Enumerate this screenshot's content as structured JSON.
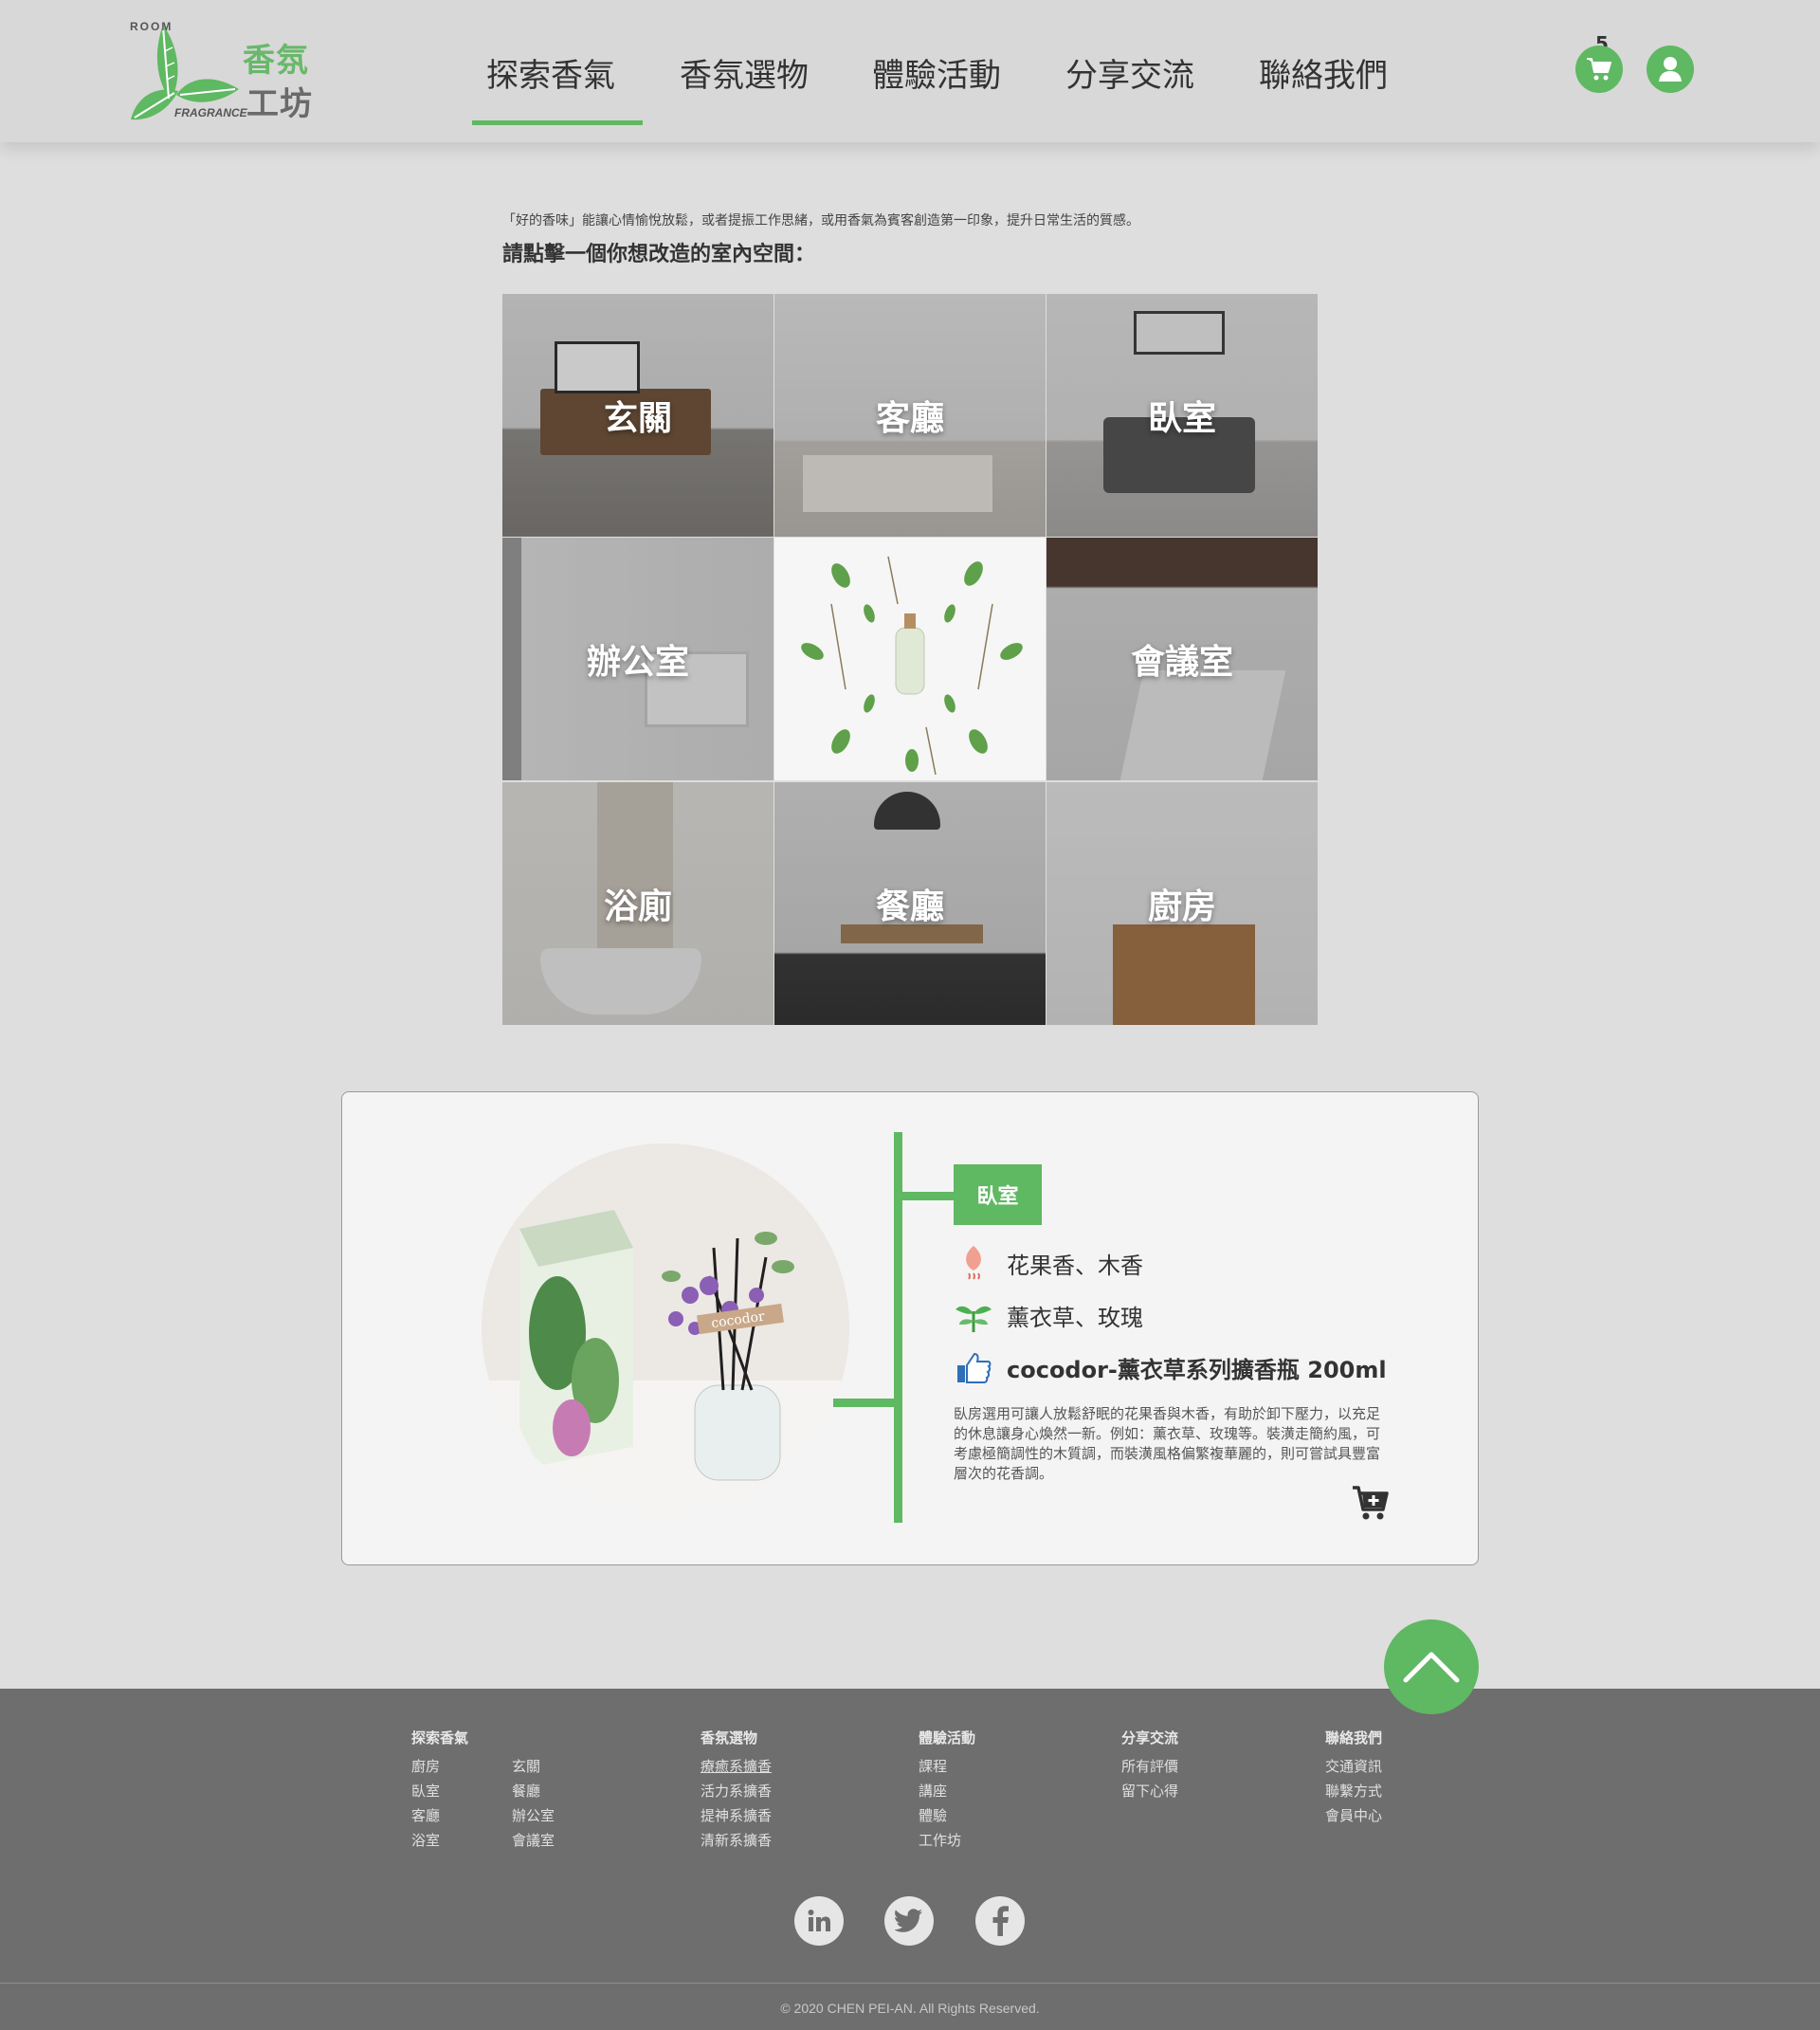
{
  "brand": {
    "logo_top": "ROOM",
    "logo_main": "香氛",
    "logo_sub": "工坊",
    "logo_bottom": "FRAGRANCE"
  },
  "nav": {
    "items": [
      {
        "label": "探索香氣"
      },
      {
        "label": "香氛選物"
      },
      {
        "label": "體驗活動"
      },
      {
        "label": "分享交流"
      },
      {
        "label": "聯絡我們"
      }
    ],
    "active_index": 0,
    "cart_count": "5"
  },
  "intro": {
    "subtitle": "「好的香味」能讓心情愉悅放鬆，或者提振工作思緒，或用香氣為賓客創造第一印象，提升日常生活的質感。",
    "title": "請點擊一個你想改造的室內空間："
  },
  "rooms": [
    {
      "label": "玄關"
    },
    {
      "label": "客廳"
    },
    {
      "label": "臥室"
    },
    {
      "label": "辦公室"
    },
    {
      "label": ""
    },
    {
      "label": "會議室"
    },
    {
      "label": "浴廁"
    },
    {
      "label": "餐廳"
    },
    {
      "label": "廚房"
    }
  ],
  "feature": {
    "tag": "臥室",
    "scent": "花果香、木香",
    "herb": "薰衣草、玫瑰",
    "product": "cocodor-薰衣草系列擴香瓶 200ml",
    "description": "臥房選用可讓人放鬆舒眠的花果香與木香，有助於卸下壓力，以充足的休息讓身心煥然一新。例如：薰衣草、玫瑰等。裝潢走簡約風，可考慮極簡調性的木質調，而裝潢風格偏繁複華麗的，則可嘗試具豐富層次的花香調。",
    "product_brand_text": "cocodor"
  },
  "footer": {
    "columns": [
      {
        "title": "探索香氣",
        "links": [
          "廚房",
          "臥室",
          "客廳",
          "浴室"
        ],
        "links2": [
          "玄關",
          "餐廳",
          "辦公室",
          "會議室"
        ]
      },
      {
        "title": "香氛選物",
        "links": [
          "療癒系擴香",
          "活力系擴香",
          "提神系擴香",
          "清新系擴香"
        ]
      },
      {
        "title": "體驗活動",
        "links": [
          "課程",
          "講座",
          "體驗",
          "工作坊"
        ]
      },
      {
        "title": "分享交流",
        "links": [
          "所有評價",
          "留下心得"
        ]
      },
      {
        "title": "聯絡我們",
        "links": [
          "交通資訊",
          "聯繫方式",
          "會員中心"
        ]
      }
    ],
    "copyright": "© 2020 CHEN PEI-AN. All Rights Reserved."
  },
  "colors": {
    "accent": "#5fb862",
    "page_bg": "#dedede",
    "footer_bg": "#6e6e6e"
  },
  "icons": [
    "cart-icon",
    "user-icon",
    "flower-icon",
    "leaf-icon",
    "thumbs-up-icon",
    "add-to-cart-icon",
    "chevron-up-icon",
    "linkedin-icon",
    "twitter-icon",
    "facebook-icon"
  ]
}
